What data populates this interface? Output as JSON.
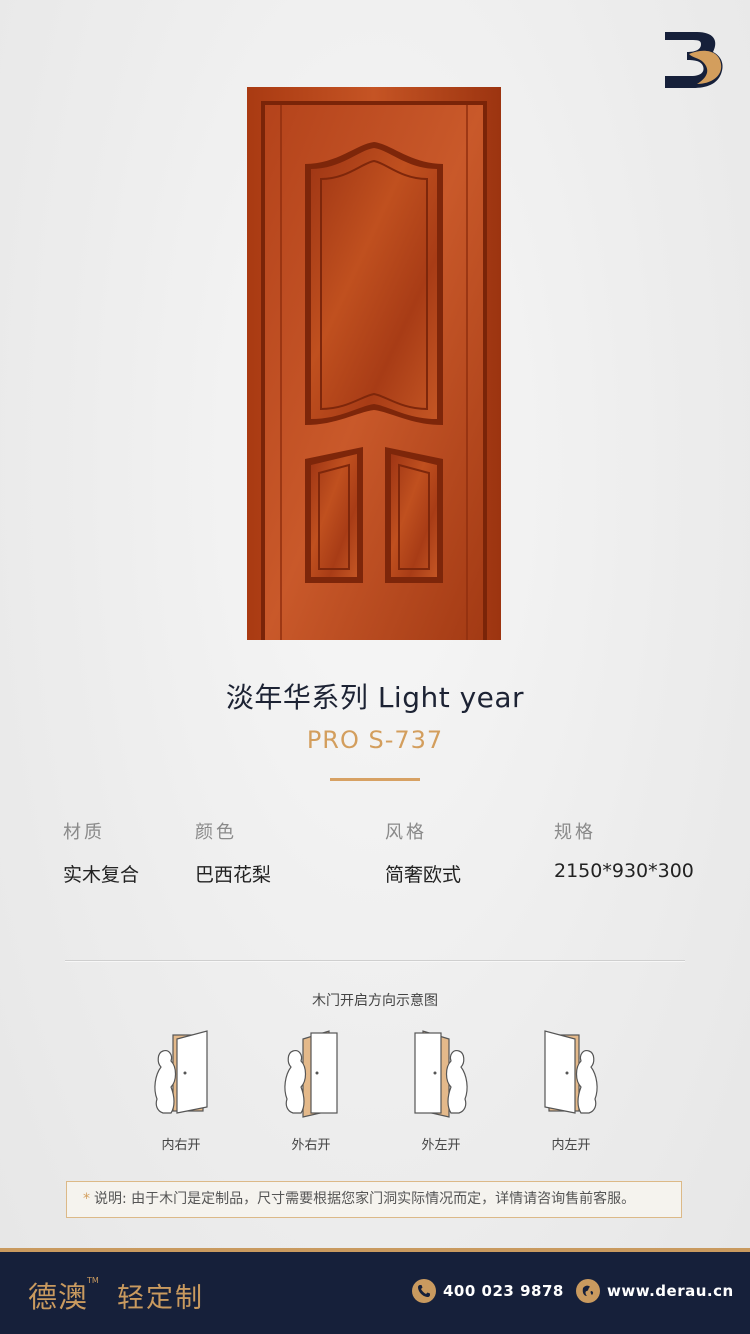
{
  "product": {
    "title": "淡年华系列  Light year",
    "model": "PRO S-737"
  },
  "specs": [
    {
      "label": "材质",
      "value": "实木复合"
    },
    {
      "label": "颜色",
      "value": "巴西花梨"
    },
    {
      "label": "风格",
      "value": "简奢欧式"
    },
    {
      "label": "规格",
      "value": "2150*930*300"
    }
  ],
  "opening_diagram": {
    "title": "木门开启方向示意图",
    "options": [
      {
        "label": "内右开"
      },
      {
        "label": "外右开"
      },
      {
        "label": "外左开"
      },
      {
        "label": "内左开"
      }
    ]
  },
  "note": {
    "marker": "*",
    "text": "说明: 由于木门是定制品，尺寸需要根据您家门洞实际情况而定，详情请咨询售前客服。"
  },
  "footer": {
    "brand": "德澳",
    "tm": "TM",
    "tagline": "轻定制",
    "phone": "400 023 9878",
    "website": "www.derau.cn"
  },
  "colors": {
    "accent": "#d39e5d",
    "footer_bg": "#16203a",
    "door_wood": "#b8451c"
  },
  "icons": [
    "brand-logo",
    "phone-icon",
    "globe-icon"
  ]
}
